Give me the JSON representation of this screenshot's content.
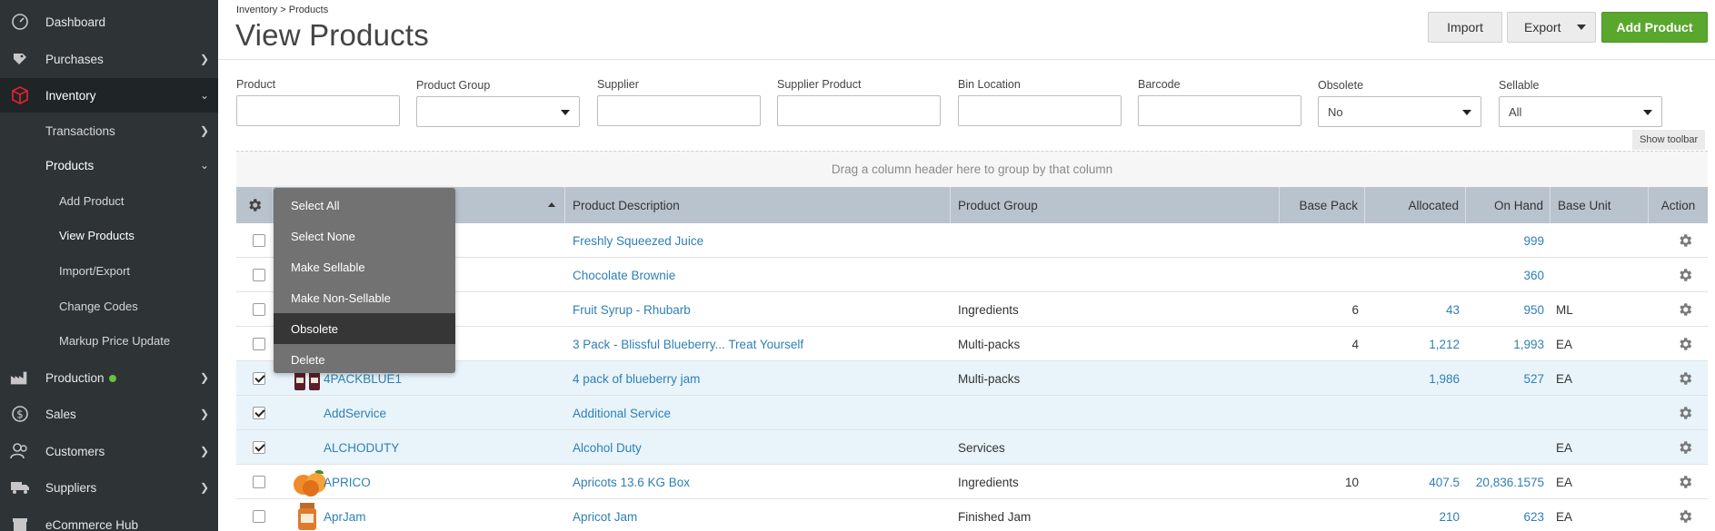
{
  "sidebar": {
    "items": [
      {
        "label": "Dashboard",
        "icon": "dashboard-icon"
      },
      {
        "label": "Purchases",
        "icon": "purchases-icon"
      },
      {
        "label": "Inventory",
        "icon": "inventory-icon"
      },
      {
        "label": "Transactions"
      },
      {
        "label": "Products"
      },
      {
        "label": "Add Product"
      },
      {
        "label": "View Products"
      },
      {
        "label": "Import/Export"
      },
      {
        "label": "Change Codes"
      },
      {
        "label": "Markup Price Update"
      },
      {
        "label": "Production",
        "icon": "production-icon"
      },
      {
        "label": "Sales",
        "icon": "sales-icon"
      },
      {
        "label": "Customers",
        "icon": "customers-icon"
      },
      {
        "label": "Suppliers",
        "icon": "suppliers-icon"
      },
      {
        "label": "eCommerce Hub",
        "icon": "ecommerce-icon"
      }
    ]
  },
  "header": {
    "breadcrumb": "Inventory > Products",
    "title": "View Products",
    "import_label": "Import",
    "export_label": "Export",
    "add_label": "Add Product"
  },
  "filters": {
    "product": {
      "label": "Product",
      "value": ""
    },
    "product_group": {
      "label": "Product Group",
      "value": ""
    },
    "supplier": {
      "label": "Supplier",
      "value": ""
    },
    "supplier_product": {
      "label": "Supplier Product",
      "value": ""
    },
    "bin_location": {
      "label": "Bin Location",
      "value": ""
    },
    "barcode": {
      "label": "Barcode",
      "value": ""
    },
    "obsolete": {
      "label": "Obsolete",
      "value": "No"
    },
    "sellable": {
      "label": "Sellable",
      "value": "All"
    }
  },
  "show_toolbar": "Show toolbar",
  "group_panel": "Drag a column header here to group by that column",
  "grid": {
    "columns": {
      "description": "Product Description",
      "group": "Product Group",
      "base_pack": "Base Pack",
      "allocated": "Allocated",
      "on_hand": "On Hand",
      "base_unit": "Base Unit",
      "action": "Action"
    },
    "rows": [
      {
        "code": "",
        "description": "Freshly Squeezed Juice",
        "group": "",
        "base_pack": "",
        "allocated": "",
        "on_hand": "999",
        "unit": "",
        "checked": false
      },
      {
        "code": "",
        "description": "Chocolate Brownie",
        "group": "",
        "base_pack": "",
        "allocated": "",
        "on_hand": "360",
        "unit": "",
        "checked": false
      },
      {
        "code": "",
        "description": "Fruit Syrup - Rhubarb",
        "group": "Ingredients",
        "base_pack": "6",
        "allocated": "43",
        "on_hand": "950",
        "unit": "ML",
        "checked": false
      },
      {
        "code": "",
        "description": "3 Pack - Blissful Blueberry... Treat Yourself",
        "group": "Multi-packs",
        "base_pack": "4",
        "allocated": "1,212",
        "on_hand": "1,993",
        "unit": "EA",
        "checked": false
      },
      {
        "code": "4PACKBLUE1",
        "description": "4 pack of blueberry jam",
        "group": "Multi-packs",
        "base_pack": "",
        "allocated": "1,986",
        "on_hand": "527",
        "unit": "EA",
        "checked": true,
        "thumb": "jam-jars"
      },
      {
        "code": "AddService",
        "description": "Additional Service",
        "group": "",
        "base_pack": "",
        "allocated": "",
        "on_hand": "",
        "unit": "",
        "checked": true
      },
      {
        "code": "ALCHODUTY",
        "description": "Alcohol Duty",
        "group": "Services",
        "base_pack": "",
        "allocated": "",
        "on_hand": "",
        "unit": "EA",
        "checked": true
      },
      {
        "code": "APRICO",
        "description": "Apricots 13.6 KG Box",
        "group": "Ingredients",
        "base_pack": "10",
        "allocated": "407.5",
        "on_hand": "20,836.1575",
        "unit": "EA",
        "checked": false,
        "thumb": "apricots"
      },
      {
        "code": "AprJam",
        "description": "Apricot Jam",
        "group": "Finished Jam",
        "base_pack": "",
        "allocated": "210",
        "on_hand": "623",
        "unit": "EA",
        "checked": false,
        "thumb": "jam-jar"
      }
    ]
  },
  "menu": {
    "items": [
      "Select All",
      "Select None",
      "Make Sellable",
      "Make Non-Sellable",
      "Obsolete",
      "Delete"
    ],
    "highlighted": "Obsolete"
  },
  "colors": {
    "sidebar_bg": "#2e3436",
    "accent_red": "#d9232e",
    "add_button": "#5aa72d",
    "link": "#2f7fb5",
    "header_row": "#b9c3ce",
    "selected_row": "#e8f4fa"
  }
}
